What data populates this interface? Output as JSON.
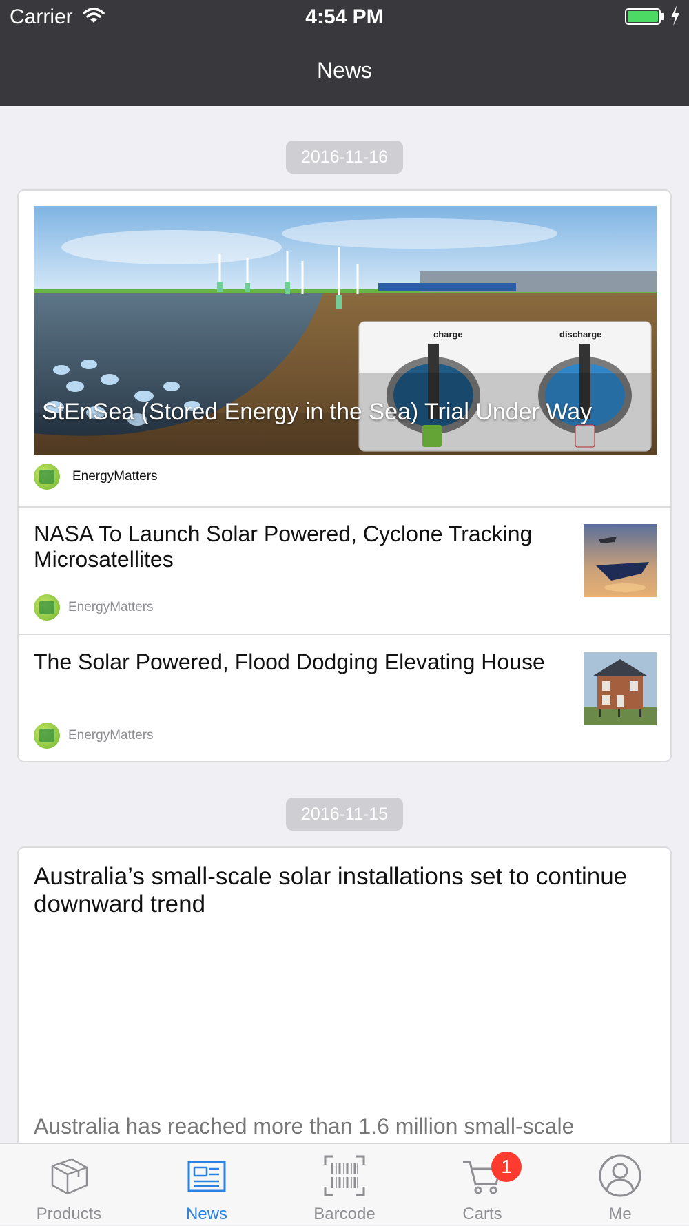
{
  "status_bar": {
    "carrier": "Carrier",
    "time": "4:54 PM"
  },
  "nav": {
    "title": "News"
  },
  "sections": [
    {
      "date": "2016-11-16",
      "hero": {
        "caption": "StEnSea (Stored Energy in the Sea) Trial Under Way",
        "source": "EnergyMatters",
        "inset_labels": [
          "charge",
          "discharge"
        ]
      },
      "items": [
        {
          "title": "NASA To Launch Solar Powered, Cyclone Tracking Microsatellites",
          "source": "EnergyMatters"
        },
        {
          "title": "The Solar Powered, Flood Dodging Elevating House",
          "source": "EnergyMatters"
        }
      ]
    },
    {
      "date": "2016-11-15",
      "article": {
        "title": "Australia’s small-scale solar installations set to continue downward trend",
        "summary": "Australia has reached more than 1.6 million small-scale"
      }
    }
  ],
  "tabs": [
    {
      "label": "Products",
      "icon": "box-icon"
    },
    {
      "label": "News",
      "icon": "newspaper-icon",
      "active": true
    },
    {
      "label": "Barcode",
      "icon": "barcode-icon"
    },
    {
      "label": "Carts",
      "icon": "cart-icon",
      "badge": "1"
    },
    {
      "label": "Me",
      "icon": "user-icon"
    }
  ],
  "colors": {
    "bar": "#38383d",
    "accent": "#2a82e4",
    "badge": "#ff3b30",
    "background": "#efeff4"
  }
}
